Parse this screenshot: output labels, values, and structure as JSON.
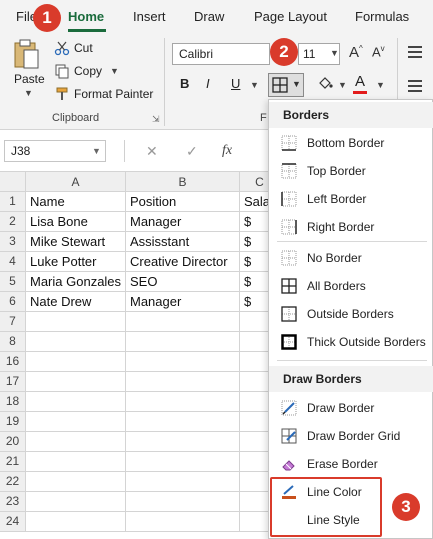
{
  "ribbon": {
    "tabs": [
      "File",
      "Home",
      "Insert",
      "Draw",
      "Page Layout",
      "Formulas"
    ],
    "active_tab": "Home",
    "clipboard": {
      "paste": "Paste",
      "cut": "Cut",
      "copy": "Copy",
      "format_painter": "Format Painter",
      "group_label": "Clipboard"
    },
    "font": {
      "name": "Calibri",
      "size": "11",
      "bold": "B",
      "italic": "I",
      "underline": "U",
      "group_label": "F"
    }
  },
  "formula_bar": {
    "name_box": "J38",
    "fx": "fx"
  },
  "sheet": {
    "columns": [
      "A",
      "B",
      "C"
    ],
    "headers": [
      "Name",
      "Position",
      "Sala"
    ],
    "rows": [
      {
        "num": "1",
        "a": "Name",
        "b": "Position",
        "c": "Sala"
      },
      {
        "num": "2",
        "a": "Lisa Bone",
        "b": "Manager",
        "c": "$"
      },
      {
        "num": "3",
        "a": "Mike Stewart",
        "b": "Assisstant",
        "c": "$"
      },
      {
        "num": "4",
        "a": "Luke Potter",
        "b": "Creative Director",
        "c": "$"
      },
      {
        "num": "5",
        "a": "Maria Gonzales",
        "b": "SEO",
        "c": "$"
      },
      {
        "num": "6",
        "a": "Nate Drew",
        "b": "Manager",
        "c": "$"
      },
      {
        "num": "7",
        "a": "",
        "b": "",
        "c": ""
      },
      {
        "num": "8",
        "a": "",
        "b": "",
        "c": ""
      },
      {
        "num": "16",
        "a": "",
        "b": "",
        "c": ""
      },
      {
        "num": "17",
        "a": "",
        "b": "",
        "c": ""
      },
      {
        "num": "18",
        "a": "",
        "b": "",
        "c": ""
      },
      {
        "num": "19",
        "a": "",
        "b": "",
        "c": ""
      },
      {
        "num": "20",
        "a": "",
        "b": "",
        "c": ""
      },
      {
        "num": "21",
        "a": "",
        "b": "",
        "c": ""
      },
      {
        "num": "22",
        "a": "",
        "b": "",
        "c": ""
      },
      {
        "num": "23",
        "a": "",
        "b": "",
        "c": ""
      },
      {
        "num": "24",
        "a": "",
        "b": "",
        "c": ""
      }
    ]
  },
  "borders_menu": {
    "section_borders": "Borders",
    "items": [
      "Bottom Border",
      "Top Border",
      "Left Border",
      "Right Border",
      "No Border",
      "All Borders",
      "Outside Borders",
      "Thick Outside Borders"
    ],
    "section_draw": "Draw Borders",
    "draw_items": [
      "Draw Border",
      "Draw Border Grid",
      "Erase Border",
      "Line Color",
      "Line Style"
    ]
  },
  "badges": [
    "1",
    "2",
    "3"
  ],
  "colors": {
    "accent_green": "#1a6b3c",
    "badge_red": "#d93b2b",
    "font_color_bar": "#e21b1b"
  }
}
